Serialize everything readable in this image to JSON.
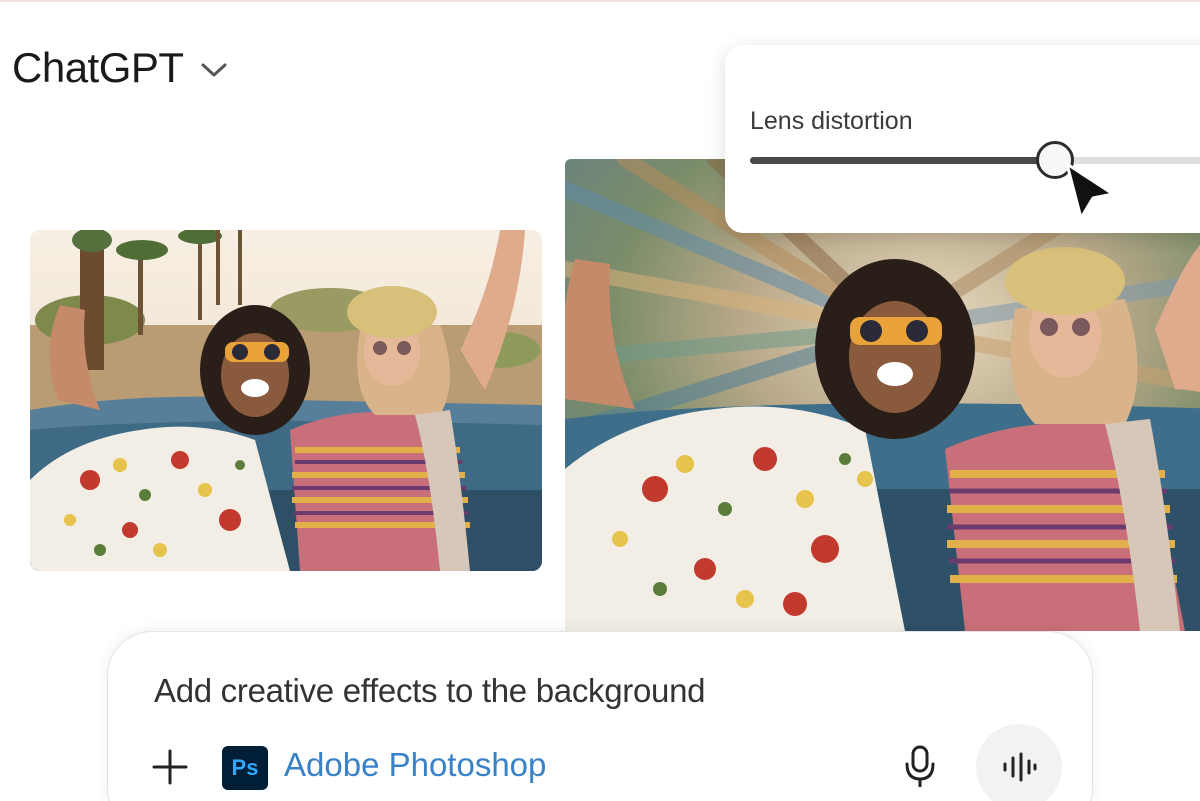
{
  "header": {
    "title": "ChatGPT",
    "chevron_icon": "chevron-down-icon"
  },
  "images": {
    "original": {
      "alt": "Original photo"
    },
    "edited": {
      "alt": "Photo with lens distortion effect"
    }
  },
  "lens_panel": {
    "label": "Lens distortion",
    "value_fraction": 0.61
  },
  "composer": {
    "prompt_text": "Add creative effects to the background",
    "tool_badge": "Ps",
    "tool_name": "Adobe Photoshop",
    "icons": {
      "add": "plus-icon",
      "mic": "microphone-icon",
      "voice": "voice-waveform-icon"
    }
  },
  "colors": {
    "tool_link": "#3a82c8",
    "ps_badge_bg": "#001e36",
    "ps_badge_fg": "#31a8ff"
  }
}
